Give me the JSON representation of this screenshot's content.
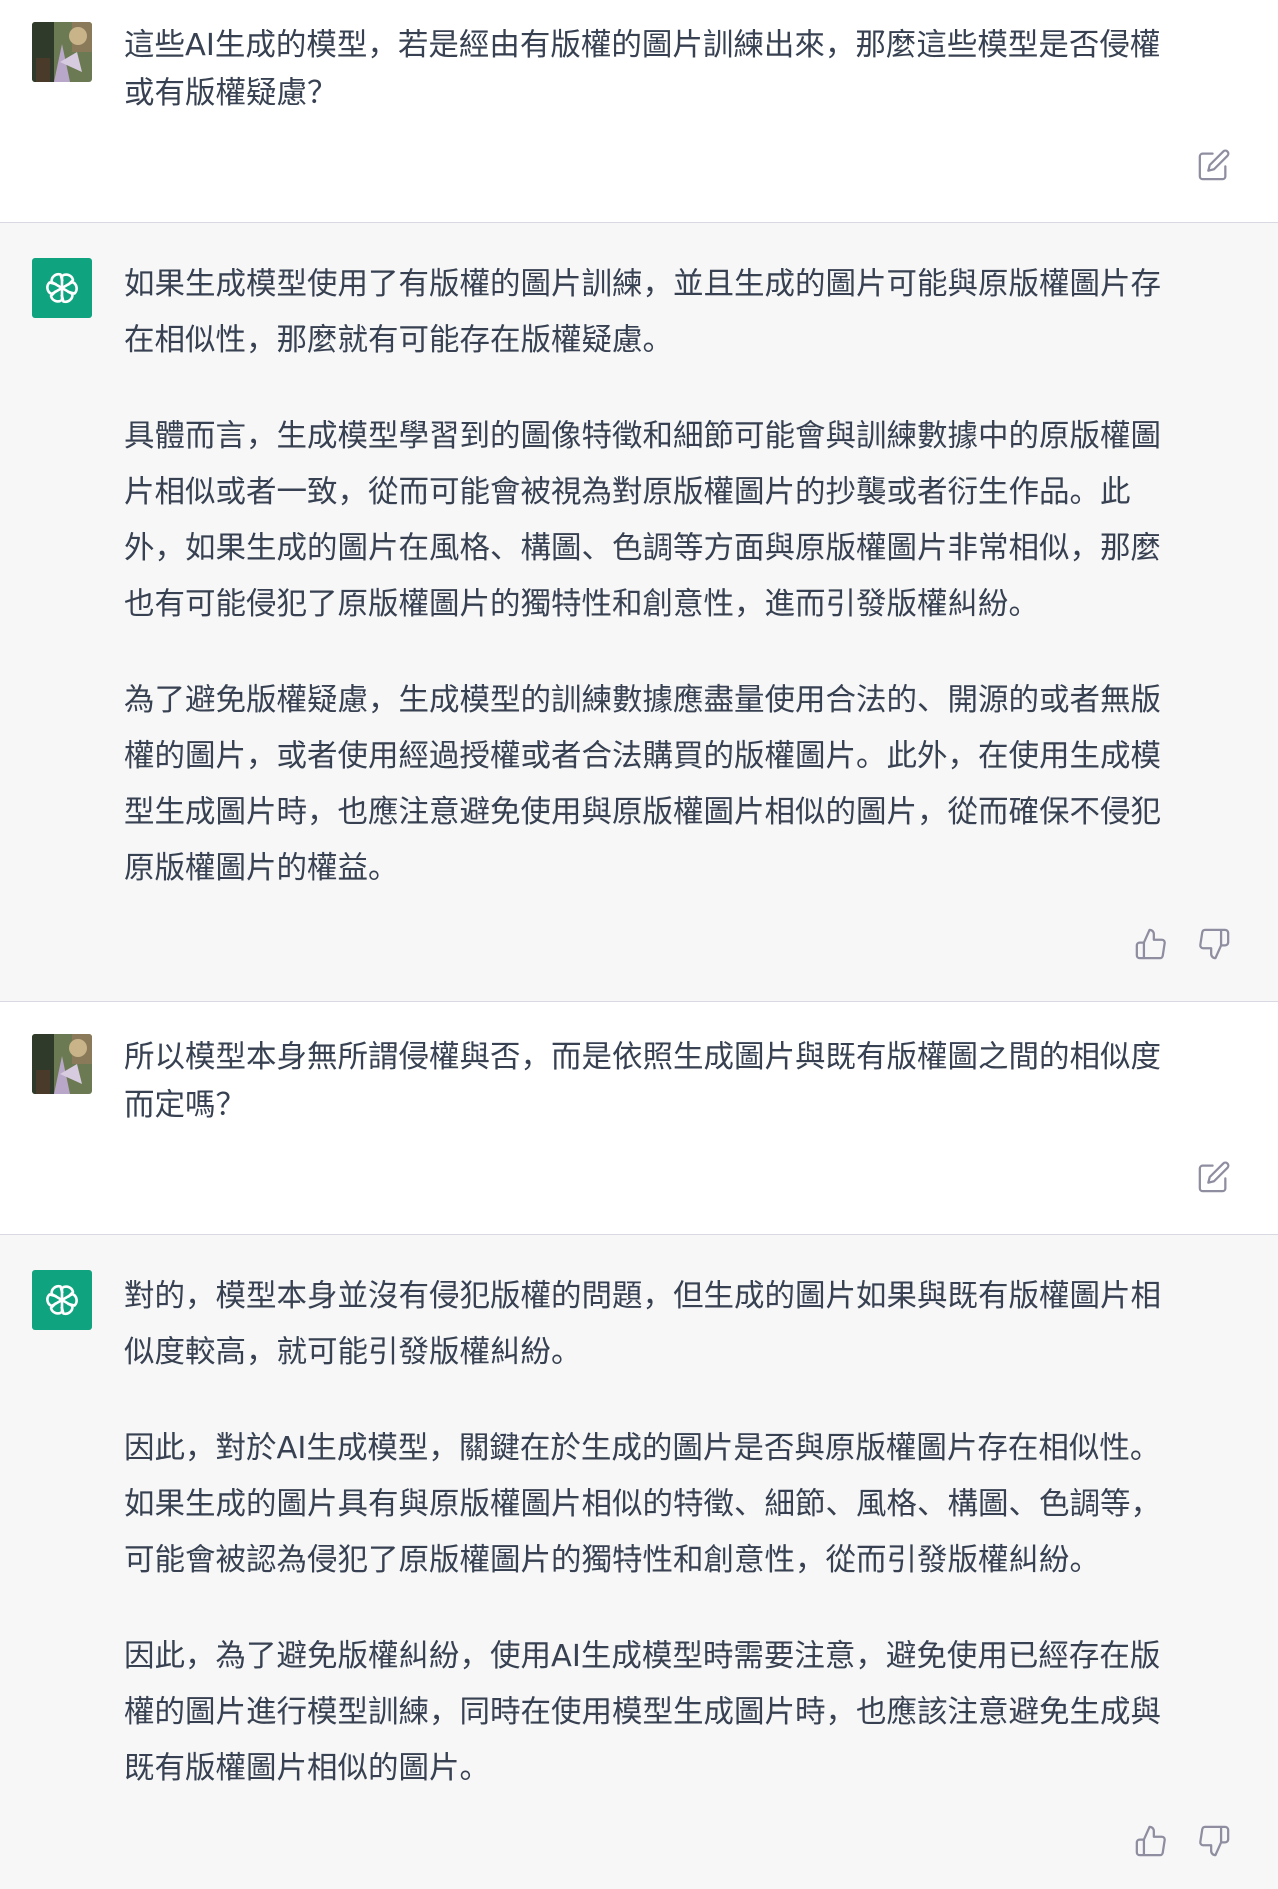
{
  "conversation": {
    "messages": [
      {
        "role": "user",
        "avatar_icon": "user-photo-avatar",
        "paragraphs": [
          "這些AI生成的模型，若是經由有版權的圖片訓練出來，那麼這些模型是否侵權\n或有版權疑慮？"
        ],
        "actions": [
          "edit-icon"
        ]
      },
      {
        "role": "assistant",
        "avatar_icon": "openai-logo-icon",
        "paragraphs": [
          "如果生成模型使用了有版權的圖片訓練，並且生成的圖片可能與原版權圖片存\n在相似性，那麼就有可能存在版權疑慮。",
          "具體而言，生成模型學習到的圖像特徵和細節可能會與訓練數據中的原版權圖\n片相似或者一致，從而可能會被視為對原版權圖片的抄襲或者衍生作品。此\n外，如果生成的圖片在風格、構圖、色調等方面與原版權圖片非常相似，那麼\n也有可能侵犯了原版權圖片的獨特性和創意性，進而引發版權糾紛。",
          "為了避免版權疑慮，生成模型的訓練數據應盡量使用合法的、開源的或者無版\n權的圖片，或者使用經過授權或者合法購買的版權圖片。此外，在使用生成模\n型生成圖片時，也應注意避免使用與原版權圖片相似的圖片，從而確保不侵犯\n原版權圖片的權益。"
        ],
        "actions": [
          "thumbs-up-icon",
          "thumbs-down-icon"
        ]
      },
      {
        "role": "user",
        "avatar_icon": "user-photo-avatar",
        "paragraphs": [
          "所以模型本身無所謂侵權與否，而是依照生成圖片與既有版權圖之間的相似度\n而定嗎？"
        ],
        "actions": [
          "edit-icon"
        ]
      },
      {
        "role": "assistant",
        "avatar_icon": "openai-logo-icon",
        "paragraphs": [
          "對的，模型本身並沒有侵犯版權的問題，但生成的圖片如果與既有版權圖片相\n似度較高，就可能引發版權糾紛。",
          "因此，對於AI生成模型，關鍵在於生成的圖片是否與原版權圖片存在相似性。\n如果生成的圖片具有與原版權圖片相似的特徵、細節、風格、構圖、色調等，\n可能會被認為侵犯了原版權圖片的獨特性和創意性，從而引發版權糾紛。",
          "因此，為了避免版權糾紛，使用AI生成模型時需要注意，避免使用已經存在版\n權的圖片進行模型訓練，同時在使用模型生成圖片時，也應該注意避免生成與\n既有版權圖片相似的圖片。"
        ],
        "actions": [
          "thumbs-up-icon",
          "thumbs-down-icon"
        ]
      }
    ]
  },
  "colors": {
    "user_bg": "#ffffff",
    "assistant_bg": "#f7f7f8",
    "text": "#374151",
    "divider": "#d9d9e3",
    "gpt_avatar": "#10a37f",
    "icon": "#8e8ea0"
  }
}
